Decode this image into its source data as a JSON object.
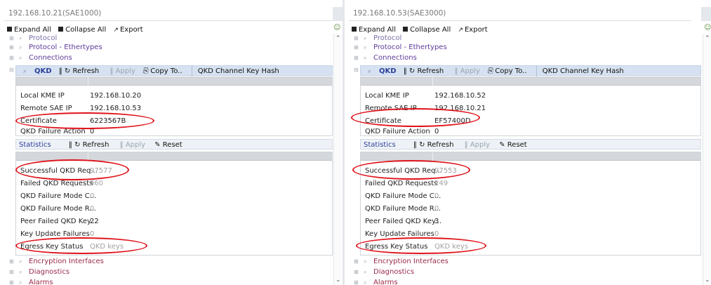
{
  "left": {
    "title": "192.168.10.21(SAE1000)",
    "toolbar": {
      "expand": "Expand All",
      "collapse": "Collapse All",
      "export": "Export"
    },
    "tree_top": [
      "Protocol",
      "Protocol - Ethertypes",
      "Connections"
    ],
    "qkd": {
      "name": "QKD",
      "refresh": "Refresh",
      "apply": "Apply",
      "copy": "Copy To..",
      "hash": "QKD Channel Key Hash"
    },
    "settings": [
      {
        "key": "Local KME IP",
        "value": "192.168.10.20"
      },
      {
        "key": "Remote SAE IP",
        "value": "192.168.10.53"
      },
      {
        "key": "Certificate",
        "value": "6223567B"
      },
      {
        "key": "QKD Failure Action",
        "value": "0"
      }
    ],
    "stats_bar": {
      "name": "Statistics",
      "refresh": "Refresh",
      "apply": "Apply",
      "reset": "Reset"
    },
    "stats": [
      {
        "key": "Successful QKD Req...",
        "value": "97577"
      },
      {
        "key": "Failed QKD Requests",
        "value": "360"
      },
      {
        "key": "QKD Failure Mode C...",
        "value": "0"
      },
      {
        "key": "QKD Failure Mode R...",
        "value": "0"
      },
      {
        "key": "Peer Failed QKD Key...",
        "value": "22"
      },
      {
        "key": "Key Update Failures",
        "value": "0"
      },
      {
        "key": "Egress Key Status",
        "value": "QKD keys"
      }
    ],
    "tree_bottom": [
      "Encryption Interfaces",
      "Diagnostics",
      "Alarms"
    ]
  },
  "right": {
    "title": "192.168.10.53(SAE3000)",
    "toolbar": {
      "expand": "Expand All",
      "collapse": "Collapse All",
      "export": "Export"
    },
    "tree_top": [
      "Protocol",
      "Protocol - Ethertypes",
      "Connections"
    ],
    "qkd": {
      "name": "QKD",
      "refresh": "Refresh",
      "apply": "Apply",
      "copy": "Copy To..",
      "hash": "QKD Channel Key Hash"
    },
    "settings": [
      {
        "key": "Local KME IP",
        "value": "192.168.10.52"
      },
      {
        "key": "Remote SAE IP",
        "value": "192.168.10.21"
      },
      {
        "key": "Certificate",
        "value": "EF57400D"
      },
      {
        "key": "QKD Failure Action",
        "value": "0"
      }
    ],
    "stats_bar": {
      "name": "Statistics",
      "refresh": "Refresh",
      "apply": "Apply",
      "reset": "Reset"
    },
    "stats": [
      {
        "key": "Successful QKD Req...",
        "value": "97553"
      },
      {
        "key": "Failed QKD Requests",
        "value": "249"
      },
      {
        "key": "QKD Failure Mode C...",
        "value": "0"
      },
      {
        "key": "QKD Failure Mode R...",
        "value": "0"
      },
      {
        "key": "Peer Failed QKD Key...",
        "value": "3"
      },
      {
        "key": "Key Update Failures",
        "value": "0"
      },
      {
        "key": "Egress Key Status",
        "value": "QKD keys"
      }
    ],
    "tree_bottom": [
      "Encryption Interfaces",
      "Diagnostics",
      "Alarms"
    ]
  },
  "icons": {
    "expand": "square-plus-icon",
    "collapse": "square-minus-icon",
    "export": "export-icon",
    "magnifier": "magnifier-icon",
    "refresh": "refresh-icon",
    "copy": "copy-icon",
    "reset": "reset-icon",
    "user": "user-icon"
  },
  "colors": {
    "highlight_ring": "#e0131b",
    "selected_row": "#d6e2f1",
    "tree_link": "#5e3a9a"
  }
}
